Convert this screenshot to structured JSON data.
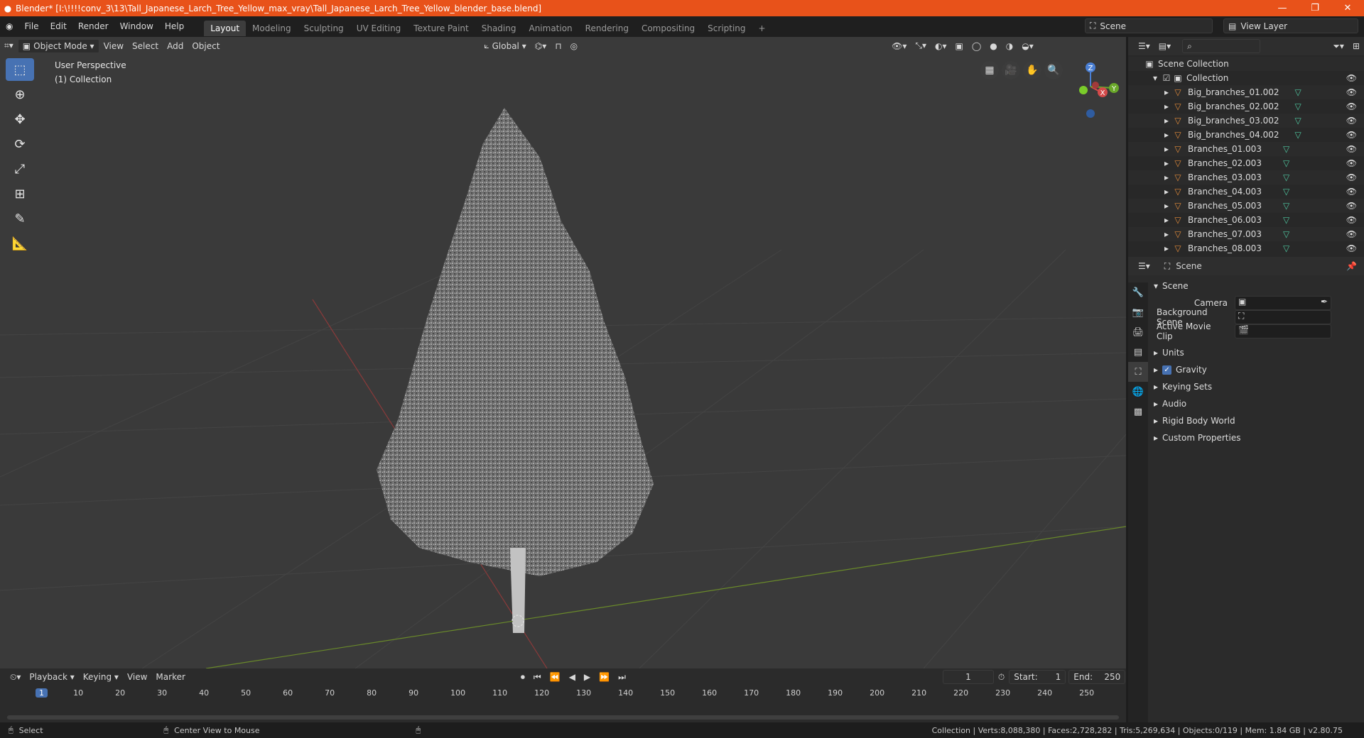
{
  "window": {
    "title": "Blender* [I:\\!!!!conv_3\\13\\Tall_Japanese_Larch_Tree_Yellow_max_vray\\Tall_Japanese_Larch_Tree_Yellow_blender_base.blend]"
  },
  "menu": [
    "File",
    "Edit",
    "Render",
    "Window",
    "Help"
  ],
  "workspaces": [
    "Layout",
    "Modeling",
    "Sculpting",
    "UV Editing",
    "Texture Paint",
    "Shading",
    "Animation",
    "Rendering",
    "Compositing",
    "Scripting"
  ],
  "active_workspace": "Layout",
  "scene_name": "Scene",
  "view_layer": "View Layer",
  "viewport_header": {
    "mode": "Object Mode",
    "view": "View",
    "select": "Select",
    "add": "Add",
    "object": "Object",
    "orientation": "Global"
  },
  "viewport": {
    "perspective": "User Perspective",
    "collection": "(1) Collection"
  },
  "gizmo": {
    "z": "Z",
    "x": "X",
    "y": "Y"
  },
  "outliner": {
    "scene_collection": "Scene Collection",
    "collection": "Collection",
    "items": [
      "Big_branches_01.002",
      "Big_branches_02.002",
      "Big_branches_03.002",
      "Big_branches_04.002",
      "Branches_01.003",
      "Branches_02.003",
      "Branches_03.003",
      "Branches_04.003",
      "Branches_05.003",
      "Branches_06.003",
      "Branches_07.003",
      "Branches_08.003"
    ]
  },
  "properties": {
    "context": "Scene",
    "section": "Scene",
    "camera_label": "Camera",
    "background_scene_label": "Background Scene",
    "active_movie_clip_label": "Active Movie Clip",
    "subpanels": [
      "Units",
      "Gravity",
      "Keying Sets",
      "Audio",
      "Rigid Body World",
      "Custom Properties"
    ],
    "gravity_checked": true
  },
  "timeline": {
    "playback": "Playback",
    "keying": "Keying",
    "view": "View",
    "marker": "Marker",
    "current_frame": "1",
    "start_label": "Start:",
    "start": "1",
    "end_label": "End:",
    "end": "250",
    "ticks": [
      "1",
      "10",
      "20",
      "30",
      "40",
      "50",
      "60",
      "70",
      "80",
      "90",
      "100",
      "110",
      "120",
      "130",
      "140",
      "150",
      "160",
      "170",
      "180",
      "190",
      "200",
      "210",
      "220",
      "230",
      "240",
      "250"
    ]
  },
  "status": {
    "left1": "Select",
    "left2": "Center View to Mouse",
    "right": "Collection | Verts:8,088,380 | Faces:2,728,282 | Tris:5,269,634 | Objects:0/119 | Mem: 1.84 GB | v2.80.75"
  }
}
